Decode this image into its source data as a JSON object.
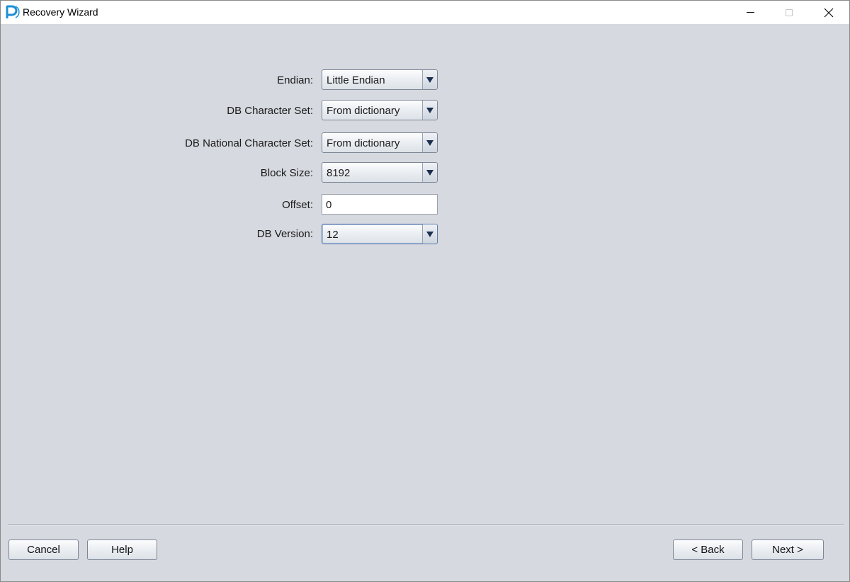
{
  "window": {
    "title": "Recovery Wizard",
    "app_icon": "p-logo-icon",
    "controls": [
      "minimize-icon",
      "maximize-icon",
      "close-icon"
    ]
  },
  "form": {
    "endian": {
      "label": "Endian:",
      "value": "Little Endian"
    },
    "db_charset": {
      "label": "DB Character Set:",
      "value": "From dictionary"
    },
    "db_national_charset": {
      "label": "DB National Character Set:",
      "value": "From dictionary"
    },
    "block_size": {
      "label": "Block Size:",
      "value": "8192"
    },
    "offset": {
      "label": "Offset:",
      "value": "0"
    },
    "db_version": {
      "label": "DB Version:",
      "value": "12"
    }
  },
  "buttons": {
    "cancel": "Cancel",
    "help": "Help",
    "back": "< Back",
    "next": "Next >"
  },
  "colors": {
    "background": "#d6d9df",
    "icon_accent": "#1e8fd6"
  }
}
